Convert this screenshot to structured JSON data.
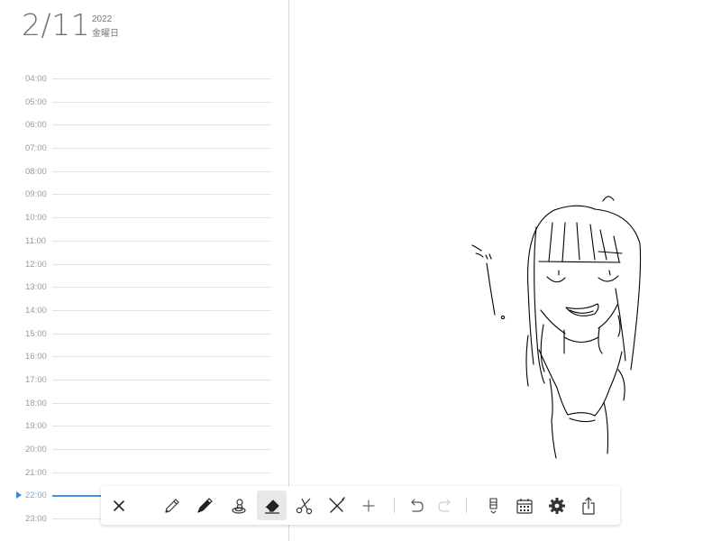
{
  "header": {
    "date": "2/11",
    "year": "2022",
    "day_of_week": "金曜日"
  },
  "timeline": {
    "hours": [
      "04:00",
      "05:00",
      "06:00",
      "07:00",
      "08:00",
      "09:00",
      "10:00",
      "11:00",
      "12:00",
      "13:00",
      "14:00",
      "15:00",
      "16:00",
      "17:00",
      "18:00",
      "19:00",
      "20:00",
      "21:00",
      "22:00",
      "23:00"
    ],
    "current_hour": "22:00"
  },
  "toolbar": {
    "tools": [
      {
        "name": "close-icon",
        "active": false
      },
      {
        "name": "pencil-icon",
        "active": false
      },
      {
        "name": "pen-icon",
        "active": false
      },
      {
        "name": "stamp-icon",
        "active": false
      },
      {
        "name": "eraser-icon",
        "active": true
      },
      {
        "name": "scissors-icon",
        "active": false
      },
      {
        "name": "ruler-icon",
        "active": false
      },
      {
        "name": "add-icon",
        "active": false
      },
      {
        "name": "undo-icon",
        "active": false
      },
      {
        "name": "redo-icon",
        "active": false,
        "disabled": true
      },
      {
        "name": "bookmark-menu-icon",
        "active": false
      },
      {
        "name": "calendar-icon",
        "active": false
      },
      {
        "name": "gear-icon",
        "active": false
      },
      {
        "name": "share-icon",
        "active": false
      }
    ]
  },
  "colors": {
    "accent": "#3d84d6",
    "active_tool_bg": "#e8e8e8",
    "ink": "#000000"
  }
}
